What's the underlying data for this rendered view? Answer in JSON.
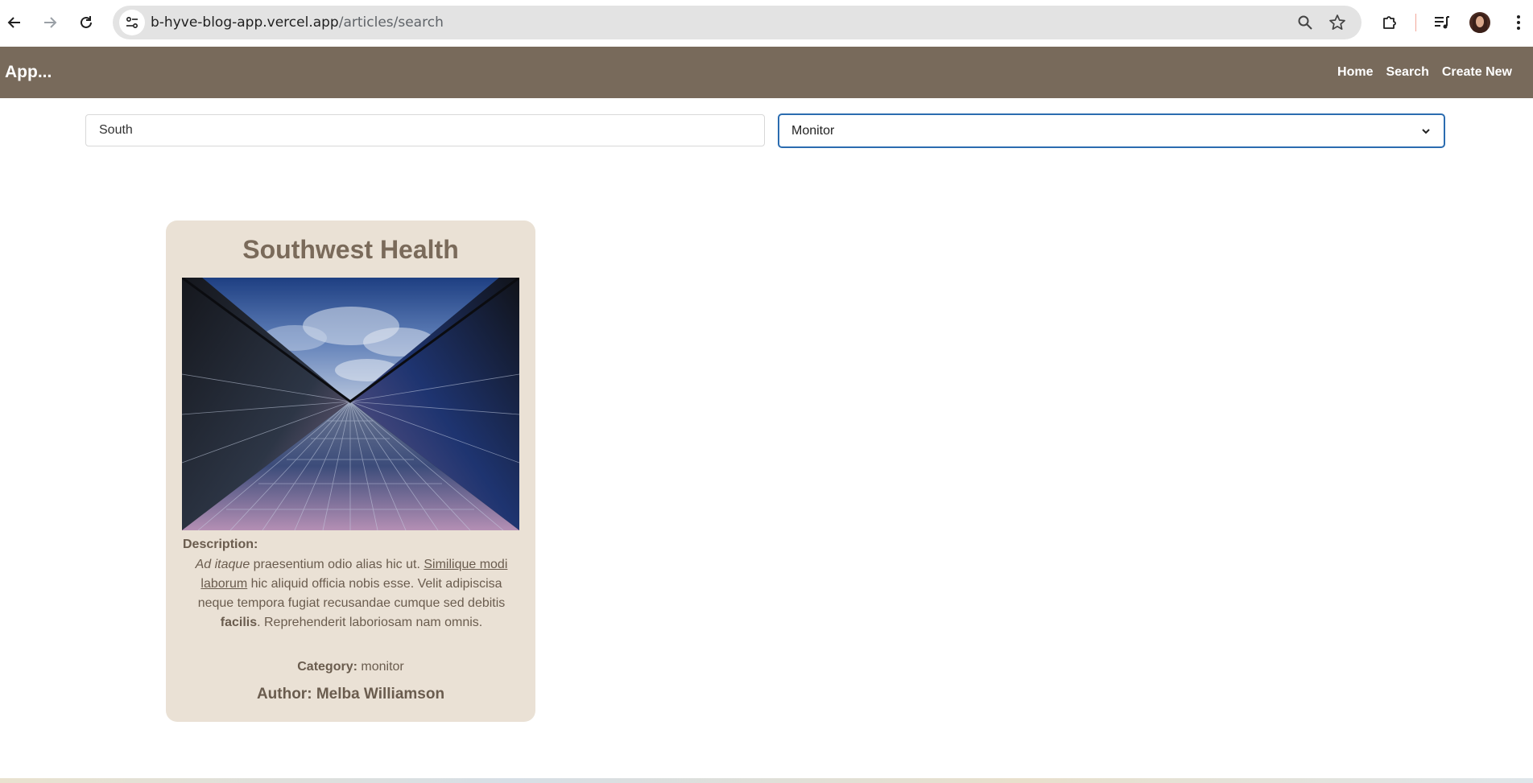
{
  "browser": {
    "url_host": "b-hyve-blog-app.vercel.app",
    "url_path": "/articles/search"
  },
  "navbar": {
    "brand": "App...",
    "links": [
      {
        "label": "Home"
      },
      {
        "label": "Search"
      },
      {
        "label": "Create New"
      }
    ]
  },
  "filters": {
    "search_value": "South",
    "category_selected": "Monitor"
  },
  "card": {
    "title": "Southwest Health",
    "description_label": "Description:",
    "description": {
      "italic_lead": "Ad itaque",
      "part1": " praesentium odio alias hic ut. ",
      "underlined": "Similique modi laborum",
      "part2": " hic aliquid officia nobis esse. Velit adipiscisa neque tempora fugiat recusandae cumque sed debitis ",
      "bold_word": "facilis",
      "part3": ". Reprehenderit laboriosam nam omnis."
    },
    "category_label": "Category:",
    "category_value": "monitor",
    "author_label": "Author:",
    "author_name": "Melba Williamson"
  },
  "colors": {
    "navbar_bg": "#786a5b",
    "card_bg": "#eae1d5",
    "select_focus_border": "#2b6cb0"
  }
}
